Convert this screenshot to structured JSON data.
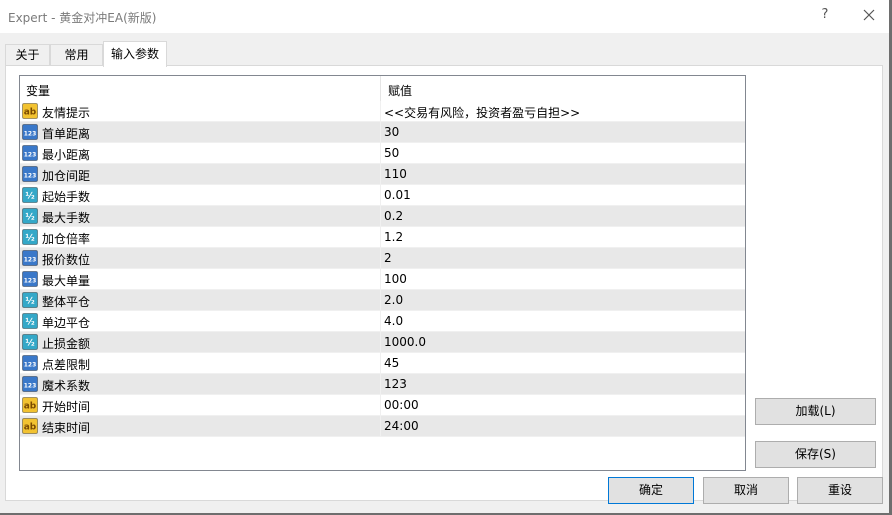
{
  "window": {
    "title": "Expert - 黄金对冲EA(新版)",
    "help": "?"
  },
  "tabs": [
    {
      "label": "关于"
    },
    {
      "label": "常用"
    },
    {
      "label": "输入参数"
    }
  ],
  "table": {
    "headers": {
      "variable": "变量",
      "value": "赋值"
    },
    "rows": [
      {
        "name": "友情提示",
        "value": "<<交易有风险，投资者盈亏自担>>",
        "type": "string"
      },
      {
        "name": "首单距离",
        "value": "30",
        "type": "int"
      },
      {
        "name": "最小距离",
        "value": "50",
        "type": "int"
      },
      {
        "name": "加仓间距",
        "value": "110",
        "type": "int"
      },
      {
        "name": "起始手数",
        "value": "0.01",
        "type": "double"
      },
      {
        "name": "最大手数",
        "value": "0.2",
        "type": "double"
      },
      {
        "name": "加仓倍率",
        "value": "1.2",
        "type": "double"
      },
      {
        "name": "报价数位",
        "value": "2",
        "type": "int"
      },
      {
        "name": "最大单量",
        "value": "100",
        "type": "int"
      },
      {
        "name": "整体平仓",
        "value": "2.0",
        "type": "double"
      },
      {
        "name": "单边平仓",
        "value": "4.0",
        "type": "double"
      },
      {
        "name": "止损金额",
        "value": "1000.0",
        "type": "double"
      },
      {
        "name": "点差限制",
        "value": "45",
        "type": "int"
      },
      {
        "name": "魔术系数",
        "value": "123",
        "type": "int"
      },
      {
        "name": "开始时间",
        "value": "00:00",
        "type": "string"
      },
      {
        "name": "结束时间",
        "value": "24:00",
        "type": "string"
      }
    ]
  },
  "icons": {
    "string": {
      "name": "string-param-icon",
      "text": "ab"
    },
    "int": {
      "name": "integer-param-icon",
      "text": "123"
    },
    "double": {
      "name": "double-param-icon",
      "text": "½"
    }
  },
  "buttons": {
    "load": "加载(L)",
    "save": "保存(S)",
    "ok": "确定",
    "cancel": "取消",
    "reset": "重设"
  },
  "colors": {
    "accent": "#0078d7",
    "string_icon": "#f2c230",
    "int_icon": "#3a78c9",
    "double_icon": "#34a8c8"
  }
}
